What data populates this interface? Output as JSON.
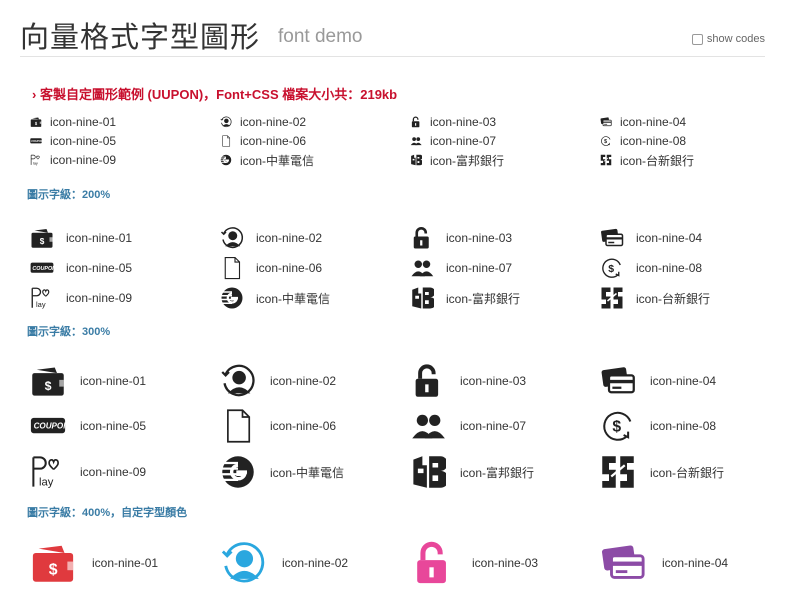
{
  "header": {
    "title": "向量格式字型圖形",
    "subtitle": "font demo",
    "show_codes_label": "show codes"
  },
  "notice": "› 客製自定圖形範例 (UUPON)，Font+CSS 檔案大小共：219kb",
  "colors": {
    "notice": "#c8102e",
    "section_label": "#3a7ca5",
    "icon_red": "#e03a3e",
    "icon_blue": "#2aa7df",
    "icon_pink": "#e8479a",
    "icon_purple": "#8c4ba6"
  },
  "sections": [
    {
      "label": "",
      "icons": [
        {
          "name": "icon-nine-01",
          "icon": "wallet-icon"
        },
        {
          "name": "icon-nine-02",
          "icon": "user-circle-icon"
        },
        {
          "name": "icon-nine-03",
          "icon": "unlock-icon"
        },
        {
          "name": "icon-nine-04",
          "icon": "credit-cards-icon"
        },
        {
          "name": "icon-nine-05",
          "icon": "coupon-icon"
        },
        {
          "name": "icon-nine-06",
          "icon": "document-icon"
        },
        {
          "name": "icon-nine-07",
          "icon": "users-icon"
        },
        {
          "name": "icon-nine-08",
          "icon": "dollar-refresh-icon"
        },
        {
          "name": "icon-nine-09",
          "icon": "play-logo-icon"
        },
        {
          "name": "icon-中華電信",
          "icon": "cht-logo-icon"
        },
        {
          "name": "icon-富邦銀行",
          "icon": "fubon-logo-icon"
        },
        {
          "name": "icon-台新銀行",
          "icon": "taishin-logo-icon"
        }
      ]
    },
    {
      "label": "圖示字級：200%",
      "icons": [
        {
          "name": "icon-nine-01",
          "icon": "wallet-icon"
        },
        {
          "name": "icon-nine-02",
          "icon": "user-circle-icon"
        },
        {
          "name": "icon-nine-03",
          "icon": "unlock-icon"
        },
        {
          "name": "icon-nine-04",
          "icon": "credit-cards-icon"
        },
        {
          "name": "icon-nine-05",
          "icon": "coupon-icon"
        },
        {
          "name": "icon-nine-06",
          "icon": "document-icon"
        },
        {
          "name": "icon-nine-07",
          "icon": "users-icon"
        },
        {
          "name": "icon-nine-08",
          "icon": "dollar-refresh-icon"
        },
        {
          "name": "icon-nine-09",
          "icon": "play-logo-icon"
        },
        {
          "name": "icon-中華電信",
          "icon": "cht-logo-icon"
        },
        {
          "name": "icon-富邦銀行",
          "icon": "fubon-logo-icon"
        },
        {
          "name": "icon-台新銀行",
          "icon": "taishin-logo-icon"
        }
      ]
    },
    {
      "label": "圖示字級：300%",
      "icons": [
        {
          "name": "icon-nine-01",
          "icon": "wallet-icon"
        },
        {
          "name": "icon-nine-02",
          "icon": "user-circle-icon"
        },
        {
          "name": "icon-nine-03",
          "icon": "unlock-icon"
        },
        {
          "name": "icon-nine-04",
          "icon": "credit-cards-icon"
        },
        {
          "name": "icon-nine-05",
          "icon": "coupon-icon"
        },
        {
          "name": "icon-nine-06",
          "icon": "document-icon"
        },
        {
          "name": "icon-nine-07",
          "icon": "users-icon"
        },
        {
          "name": "icon-nine-08",
          "icon": "dollar-refresh-icon"
        },
        {
          "name": "icon-nine-09",
          "icon": "play-logo-icon"
        },
        {
          "name": "icon-中華電信",
          "icon": "cht-logo-icon"
        },
        {
          "name": "icon-富邦銀行",
          "icon": "fubon-logo-icon"
        },
        {
          "name": "icon-台新銀行",
          "icon": "taishin-logo-icon"
        }
      ]
    },
    {
      "label": "圖示字級：400%，自定字型顏色",
      "icons": [
        {
          "name": "icon-nine-01",
          "icon": "wallet-icon",
          "color": "#e03a3e"
        },
        {
          "name": "icon-nine-02",
          "icon": "user-circle-icon",
          "color": "#2aa7df"
        },
        {
          "name": "icon-nine-03",
          "icon": "unlock-icon",
          "color": "#e8479a"
        },
        {
          "name": "icon-nine-04",
          "icon": "credit-cards-icon",
          "color": "#8c4ba6"
        }
      ]
    }
  ]
}
